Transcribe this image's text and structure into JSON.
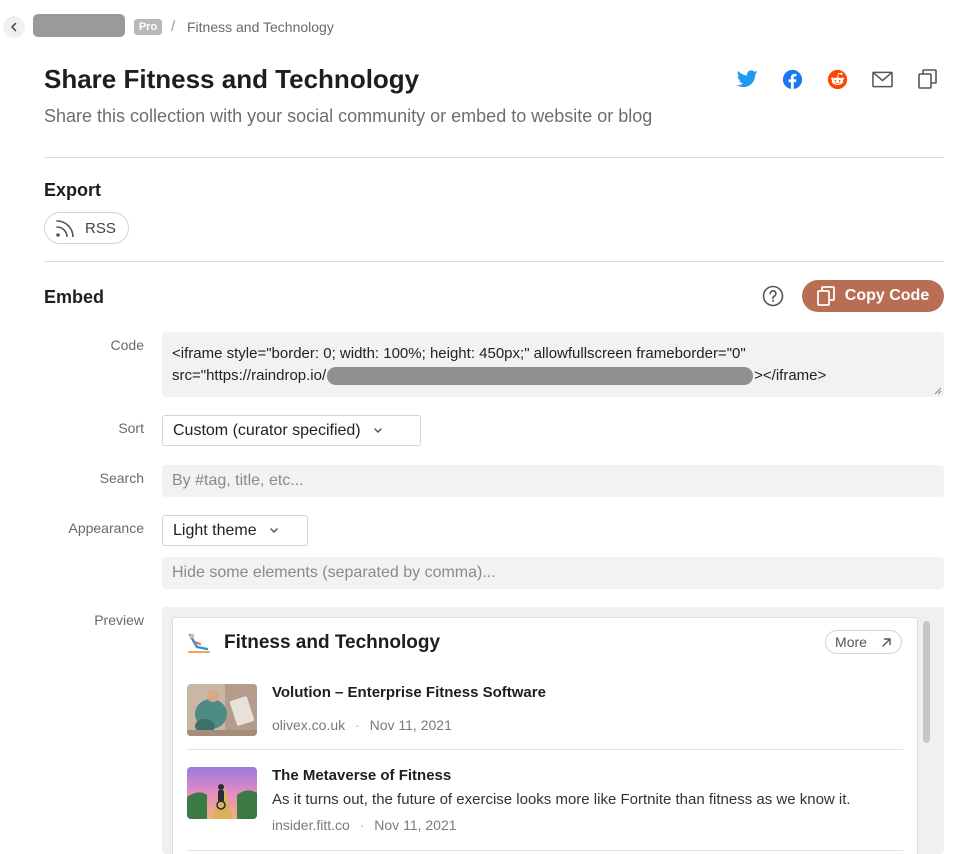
{
  "breadcrumb": {
    "badge": "Pro",
    "separator": "/",
    "current": "Fitness and Technology"
  },
  "header": {
    "title": "Share Fitness and Technology",
    "subtitle": "Share this collection with your social community or embed to website or blog",
    "share_icons": [
      "twitter-icon",
      "facebook-icon",
      "reddit-icon",
      "mail-icon",
      "copy-icon"
    ]
  },
  "export": {
    "title": "Export",
    "rss_label": "RSS"
  },
  "embed": {
    "title": "Embed",
    "copy_code_label": "Copy Code",
    "code_label": "Code",
    "code_line1": "<iframe style=\"border: 0; width: 100%; height: 450px;\" allowfullscreen frameborder=\"0\"",
    "code_line2_prefix": "src=\"https://raindrop.io/",
    "code_line2_suffix": "></iframe>",
    "sort_label": "Sort",
    "sort_value": "Custom (curator specified)",
    "search_label": "Search",
    "search_placeholder": "By #tag, title, etc...",
    "appearance_label": "Appearance",
    "appearance_value": "Light theme",
    "hide_placeholder": "Hide some elements (separated by comma)...",
    "preview_label": "Preview"
  },
  "preview": {
    "title": "Fitness and Technology",
    "more_label": "More",
    "items": [
      {
        "title": "Volution – Enterprise Fitness Software",
        "description": "",
        "domain": "olivex.co.uk",
        "dot": "·",
        "date": "Nov 11, 2021"
      },
      {
        "title": "The Metaverse of Fitness",
        "description": "As it turns out, the future of exercise looks more like Fortnite than fitness as we know it.",
        "domain": "insider.fitt.co",
        "dot": "·",
        "date": "Nov 11, 2021"
      }
    ]
  },
  "colors": {
    "accent": "#b96e53",
    "twitter": "#1d9bf0",
    "facebook": "#1877f2",
    "reddit": "#ff4500"
  }
}
